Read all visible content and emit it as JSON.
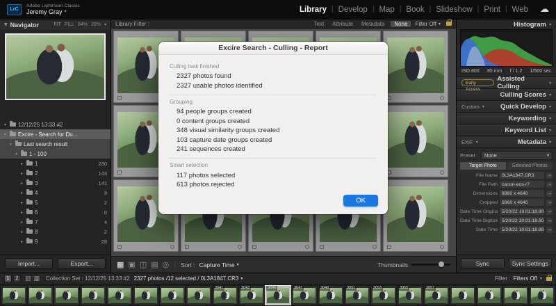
{
  "icons": {
    "caret_down": "▾",
    "caret_right": "▸",
    "triangle_down": "▼",
    "cloud": "☁",
    "goto_arrow": "→"
  },
  "accent_color": "#1a78e3",
  "top_bar": {
    "logo": "LrC",
    "app_title": "Adobe Lightroom Classic",
    "account_name": "Jeremy Gray",
    "separator": "|",
    "modules": [
      {
        "label": "Library",
        "active": true
      },
      {
        "label": "Develop"
      },
      {
        "label": "Map"
      },
      {
        "label": "Book"
      },
      {
        "label": "Slideshow"
      },
      {
        "label": "Print"
      },
      {
        "label": "Web"
      }
    ]
  },
  "left_panel": {
    "navigator": {
      "title": "Navigator",
      "zoom_options": [
        "FIT",
        "FILL",
        "84%",
        "20%"
      ]
    },
    "tree_rows": [
      {
        "label": "12/12/25 13:33 #2",
        "level": 1,
        "expanded": true
      },
      {
        "label": "Excire - Search for Du...",
        "level": 1,
        "expanded": true,
        "selected": true
      },
      {
        "label": "Last search result",
        "level": 2,
        "expanded": true,
        "highlighted": true
      },
      {
        "label": "1 - 100",
        "level": 3,
        "expanded": true,
        "highlighted": true
      },
      {
        "label": "1",
        "level": 4,
        "count": "230"
      },
      {
        "label": "2",
        "level": 4,
        "count": "143"
      },
      {
        "label": "3",
        "level": 4,
        "count": "141"
      },
      {
        "label": "4",
        "level": 4,
        "count": "9"
      },
      {
        "label": "5",
        "level": 4,
        "count": "2"
      },
      {
        "label": "6",
        "level": 4,
        "count": "6"
      },
      {
        "label": "7",
        "level": 4,
        "count": "4"
      },
      {
        "label": "8",
        "level": 4,
        "count": "2"
      },
      {
        "label": "9",
        "level": 4,
        "count": "28"
      }
    ],
    "import_button": "Import...",
    "export_button": "Export..."
  },
  "filter_bar": {
    "title": "Library Filter :",
    "options": [
      {
        "label": "Text"
      },
      {
        "label": "Attribute"
      },
      {
        "label": "Metadata"
      },
      {
        "label": "None",
        "active": true
      }
    ],
    "filter_value": "Filter Off"
  },
  "grid": {
    "cells": 15
  },
  "toolbar": {
    "view_icons": [
      {
        "name": "grid-view-icon",
        "glyph": "▦",
        "active": true
      },
      {
        "name": "loupe-view-icon",
        "glyph": "▣"
      },
      {
        "name": "compare-view-icon",
        "glyph": "◫"
      },
      {
        "name": "survey-view-icon",
        "glyph": "▤"
      },
      {
        "name": "people-view-icon",
        "glyph": "◎"
      }
    ],
    "sort_label": "Sort :",
    "sort_value": "Capture Time",
    "thumbnails_label": "Thumbnails"
  },
  "dialog": {
    "title": "Excire Search - Culling - Report",
    "sections": [
      {
        "heading": "Culling task finished",
        "lines": [
          "2327 photos found",
          "2327 usable photos identified"
        ]
      },
      {
        "heading": "Grouping",
        "lines": [
          "94 people groups created",
          "0 content groups created",
          "348 visual similarity groups created",
          "103 capture date groups created",
          "241 sequences created"
        ]
      },
      {
        "heading": "Smart selection",
        "lines": [
          "117 photos selected",
          "613 photos rejected"
        ]
      }
    ],
    "ok_label": "OK"
  },
  "right_panel": {
    "histogram": {
      "title": "Histogram",
      "stats": [
        "ISO 800",
        "85 mm",
        "f / 1.2",
        "1/500 sec"
      ],
      "colors": {
        "gray": "#cfcfcf",
        "red": "#b8382c",
        "green": "#3f9b44",
        "blue": "#3b6fd4"
      }
    },
    "panels": [
      {
        "badge": "Early Access",
        "label": "Assisted Culling"
      },
      {
        "label": "Culling Scores"
      },
      {
        "left": "Custom",
        "label": "Quick Develop"
      },
      {
        "label": "Keywording"
      },
      {
        "label": "Keyword List"
      },
      {
        "left": "EXIF",
        "label": "Metadata"
      }
    ],
    "metadata": {
      "preset_label": "Preset :",
      "preset_value": "None",
      "target_photo": "Target Photo",
      "selected_photos": "Selected Photos",
      "fields": [
        {
          "label": "File Name",
          "value": "0L3A1847.CR3"
        },
        {
          "label": "File Path",
          "value": "canon-eos-r7"
        },
        {
          "label": "Dimensions",
          "value": "6960 x 4640"
        },
        {
          "label": "Cropped",
          "value": "6960 x 4640"
        },
        {
          "label": "Date Time Original",
          "value": "5/20/22 10:01:18.800"
        },
        {
          "label": "Date Time Digitized",
          "value": "5/20/22 10:01:18.800"
        },
        {
          "label": "Date Time",
          "value": "5/20/22 10:01:18.800"
        }
      ]
    },
    "sync_button": "Sync",
    "sync_settings_button": "Sync Settings"
  },
  "status_bar": {
    "pages": [
      "1",
      "2"
    ],
    "icons": [
      {
        "name": "primary-display-icon",
        "glyph": "▥"
      },
      {
        "name": "secondary-display-icon",
        "glyph": "▦"
      }
    ],
    "breadcrumb": "Collection Set : 12/12/25 13:33 #2",
    "photo_info": "2327 photos /12 selected / 0L3A1847.CR3",
    "filter_label": "Filter :",
    "filter_value": "Filters Off"
  },
  "filmstrip": {
    "thumbs": [
      {},
      {},
      {},
      {},
      {},
      {},
      {},
      {},
      {
        "label": "3041"
      },
      {
        "label": "3043"
      },
      {
        "label": "3045",
        "selected": true
      },
      {
        "label": "3047"
      },
      {
        "label": "3049"
      },
      {
        "label": "3051"
      },
      {
        "label": "3053"
      },
      {
        "label": "3055"
      },
      {
        "label": "3057"
      },
      {},
      {},
      {},
      {}
    ]
  }
}
